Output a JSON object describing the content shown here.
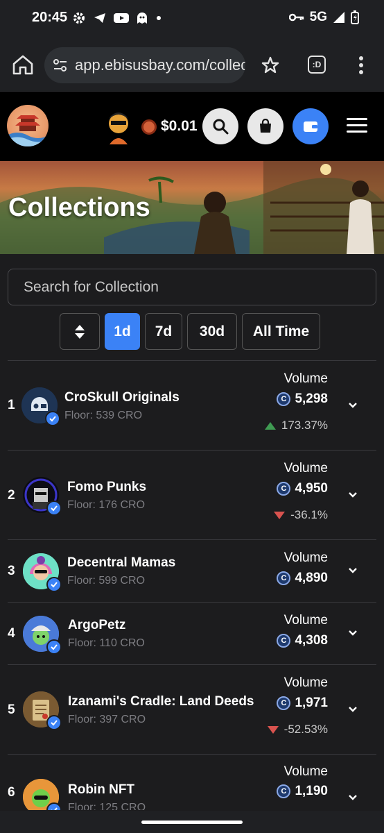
{
  "status_bar": {
    "time": "20:45",
    "network": "5G"
  },
  "browser": {
    "url": "app.ebisusbay.com/collections",
    "tab_count": ":D"
  },
  "header": {
    "balance": "$0.01"
  },
  "banner": {
    "title": "Collections"
  },
  "search": {
    "placeholder": "Search for Collection"
  },
  "filters": {
    "items": [
      "1d",
      "7d",
      "30d",
      "All Time"
    ],
    "active": "1d"
  },
  "volume_label": "Volume",
  "rows": [
    {
      "rank": "1",
      "name": "CroSkull Originals",
      "floor": "Floor: 539 CRO",
      "volume": "5,298",
      "change": "173.37%",
      "direction": "up"
    },
    {
      "rank": "2",
      "name": "Fomo Punks",
      "floor": "Floor: 176 CRO",
      "volume": "4,950",
      "change": "-36.1%",
      "direction": "down"
    },
    {
      "rank": "3",
      "name": "Decentral Mamas",
      "floor": "Floor: 599 CRO",
      "volume": "4,890"
    },
    {
      "rank": "4",
      "name": "ArgoPetz",
      "floor": "Floor: 110 CRO",
      "volume": "4,308"
    },
    {
      "rank": "5",
      "name": "Izanami's Cradle: Land Deeds",
      "floor": "Floor: 397 CRO",
      "volume": "1,971",
      "change": "-52.53%",
      "direction": "down"
    },
    {
      "rank": "6",
      "name": "Robin NFT",
      "floor": "Floor: 125 CRO",
      "volume": "1,190"
    }
  ]
}
